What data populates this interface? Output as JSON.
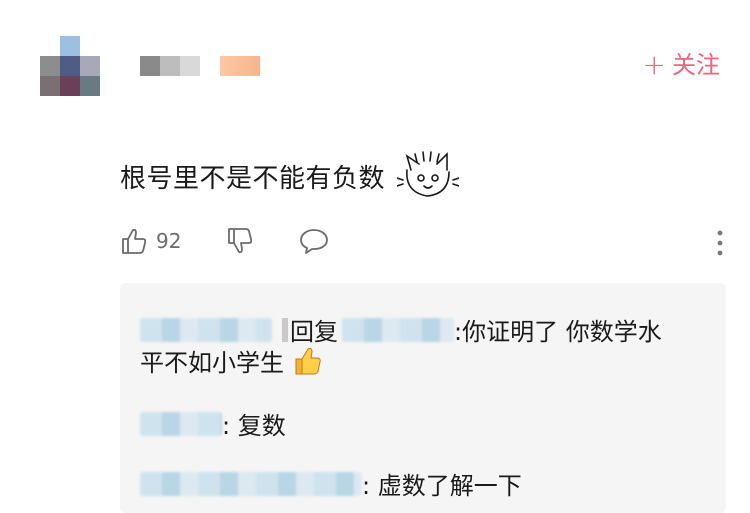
{
  "header": {
    "follow_label": "关注",
    "follow_plus": "+",
    "follow_color": "#f0637c"
  },
  "comment": {
    "text": "根号里不是不能有负数",
    "sticker_icon": "cat-face-sticker-icon"
  },
  "actions": {
    "like_count": "92",
    "like_icon": "thumbs-up-icon",
    "dislike_icon": "thumbs-down-icon",
    "reply_icon": "comment-bubble-icon",
    "more_icon": "more-vertical-icon"
  },
  "replies": [
    {
      "reply_word": "回复",
      "text_part1": ":你证明了 你数学水",
      "text_part2": "平不如小学生",
      "emoji": "thumbs-up-emoji-icon"
    },
    {
      "text": ": 复数"
    },
    {
      "text": ": 虚数了解一下"
    }
  ]
}
